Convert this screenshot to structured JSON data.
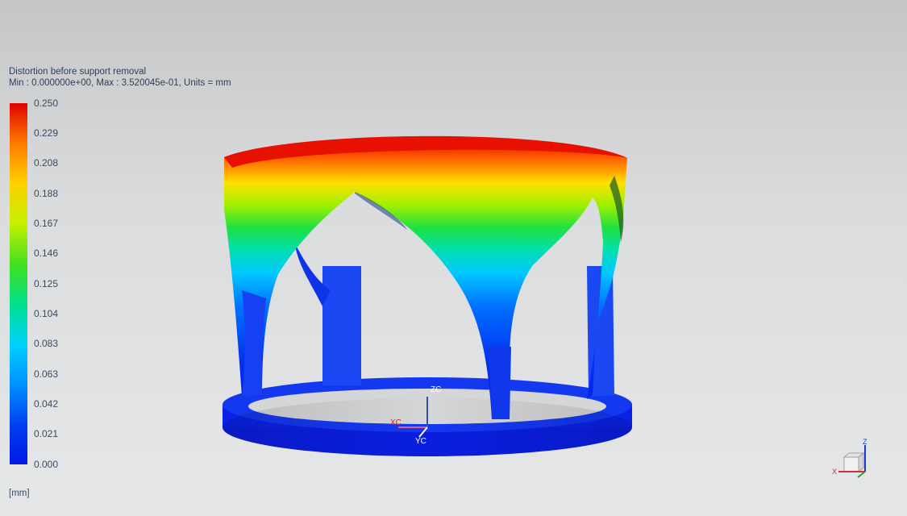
{
  "legend": {
    "title": "Distortion before support removal",
    "subtitle": "Min : 0.000000e+00, Max : 3.520045e-01, Units = mm",
    "ticks": [
      "0.250",
      "0.229",
      "0.208",
      "0.188",
      "0.167",
      "0.146",
      "0.125",
      "0.104",
      "0.083",
      "0.063",
      "0.042",
      "0.021",
      "0.000"
    ],
    "units": "[mm]"
  },
  "axes": {
    "origin_x": "XC",
    "origin_y": "YC",
    "origin_z": "ZC",
    "triad_x": "X",
    "triad_z": "Z"
  },
  "colors": {
    "max": "#e00000",
    "mid": "#3fe020",
    "min": "#0018e8"
  }
}
